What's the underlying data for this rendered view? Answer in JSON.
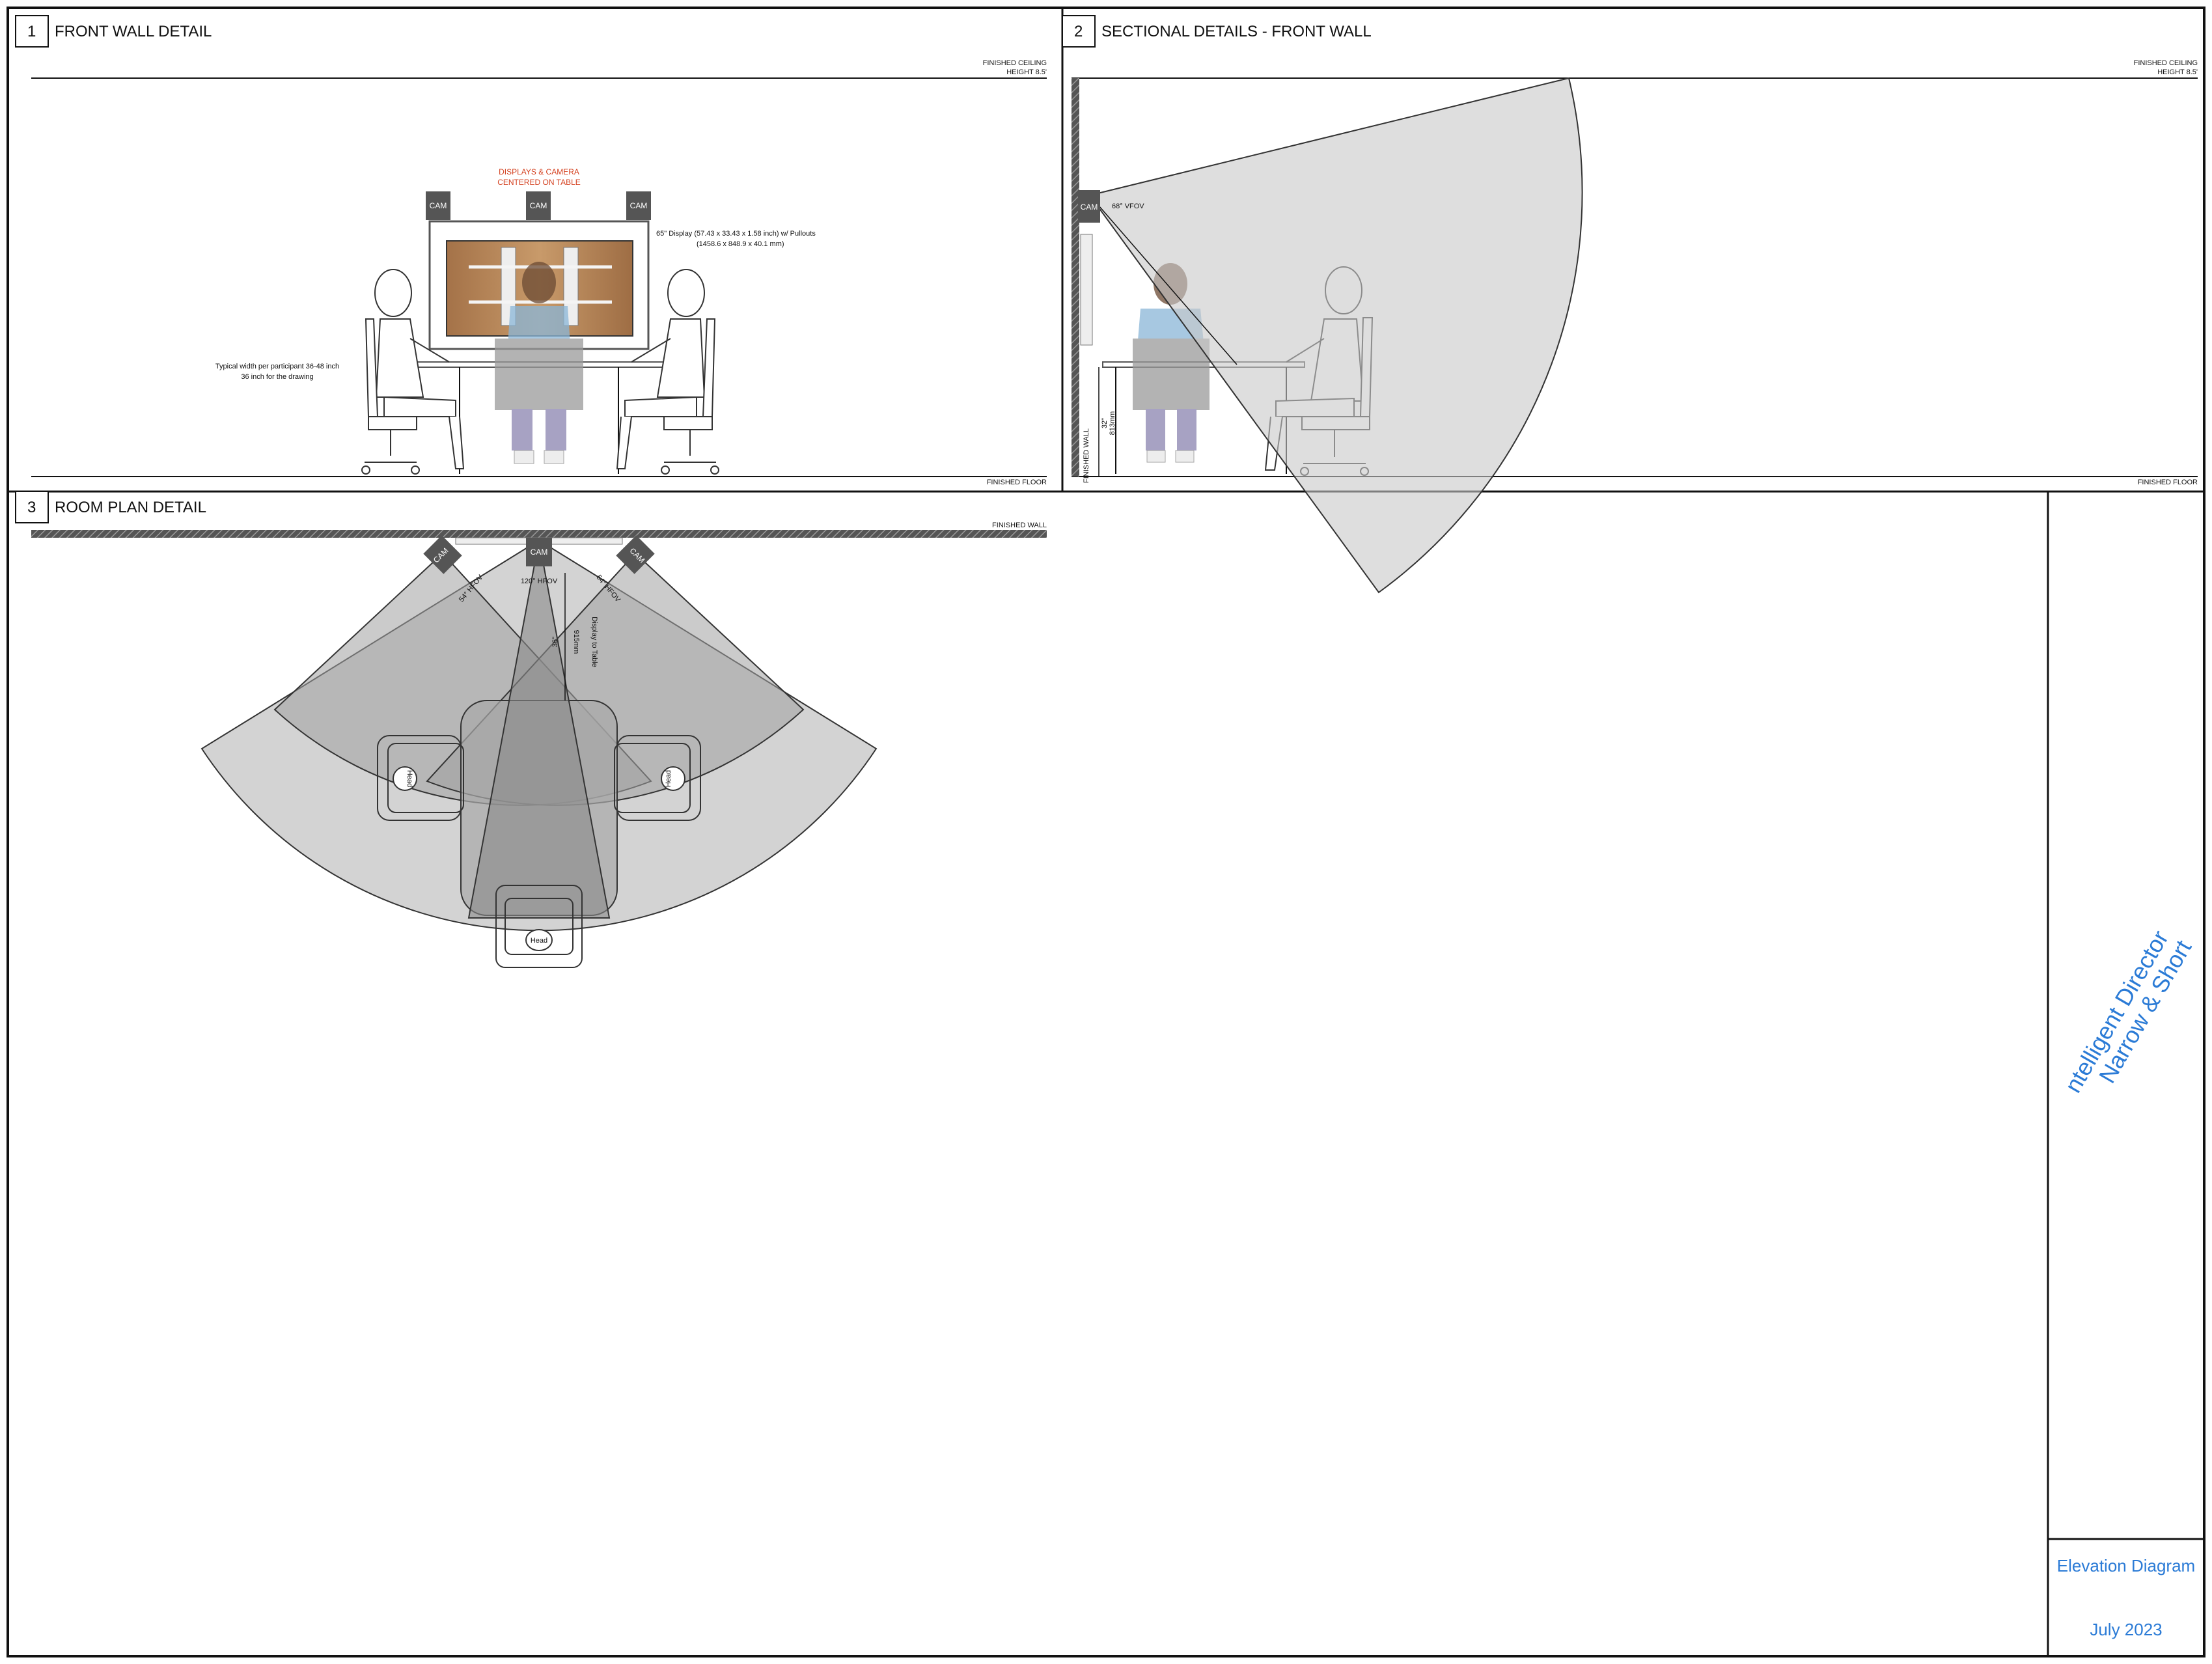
{
  "panels": {
    "front_wall": {
      "number": "1",
      "title": "FRONT WALL DETAIL",
      "ceiling_label_1": "FINISHED CEILING",
      "ceiling_label_2": "HEIGHT  8.5'",
      "floor_label": "FINISHED FLOOR",
      "centered_note_1": "DISPLAYS & CAMERA",
      "centered_note_2": "CENTERED ON TABLE",
      "display_note_1": "65\" Display (57.43 x 33.43 x 1.58 inch) w/ Pullouts",
      "display_note_2": "(1458.6 x 848.9 x 40.1 mm)",
      "width_note_1": "Typical width per participant 36-48 inch",
      "width_note_2": "36 inch for the drawing",
      "cam_left": "CAM",
      "cam_center": "CAM",
      "cam_right": "CAM"
    },
    "sectional": {
      "number": "2",
      "title": "SECTIONAL DETAILS - FRONT WALL",
      "ceiling_label_1": "FINISHED CEILING",
      "ceiling_label_2": "HEIGHT  8.5'",
      "floor_label": "FINISHED FLOOR",
      "cam": "CAM",
      "vfov": "68° VFOV",
      "height_in": "32\"",
      "height_mm": "813mm",
      "wall_label": "FINISHED WALL"
    },
    "room_plan": {
      "number": "3",
      "title": "ROOM PLAN DETAIL",
      "wall_label": "FINISHED WALL",
      "cam_left": "CAM",
      "cam_center": "CAM",
      "cam_right": "CAM",
      "hfov_left": "54° HFOV",
      "hfov_center": "120° HFOV",
      "hfov_right": "54° HFOV",
      "dist_in": "36\"",
      "dist_mm": "915mm",
      "dist_label": "Display to Table",
      "head_label": "Head"
    }
  },
  "title_block": {
    "project_line_1": "ntelligent Director",
    "project_line_2": "Narrow & Short",
    "sheet_title": "Elevation Diagram",
    "date": "July 2023"
  },
  "colors": {
    "accent_blue": "#2b7bd6",
    "note_red": "#d4401f",
    "camera": "#555555",
    "fov_fill": "#c8c8c8",
    "table_wood": "#b88a5a"
  }
}
